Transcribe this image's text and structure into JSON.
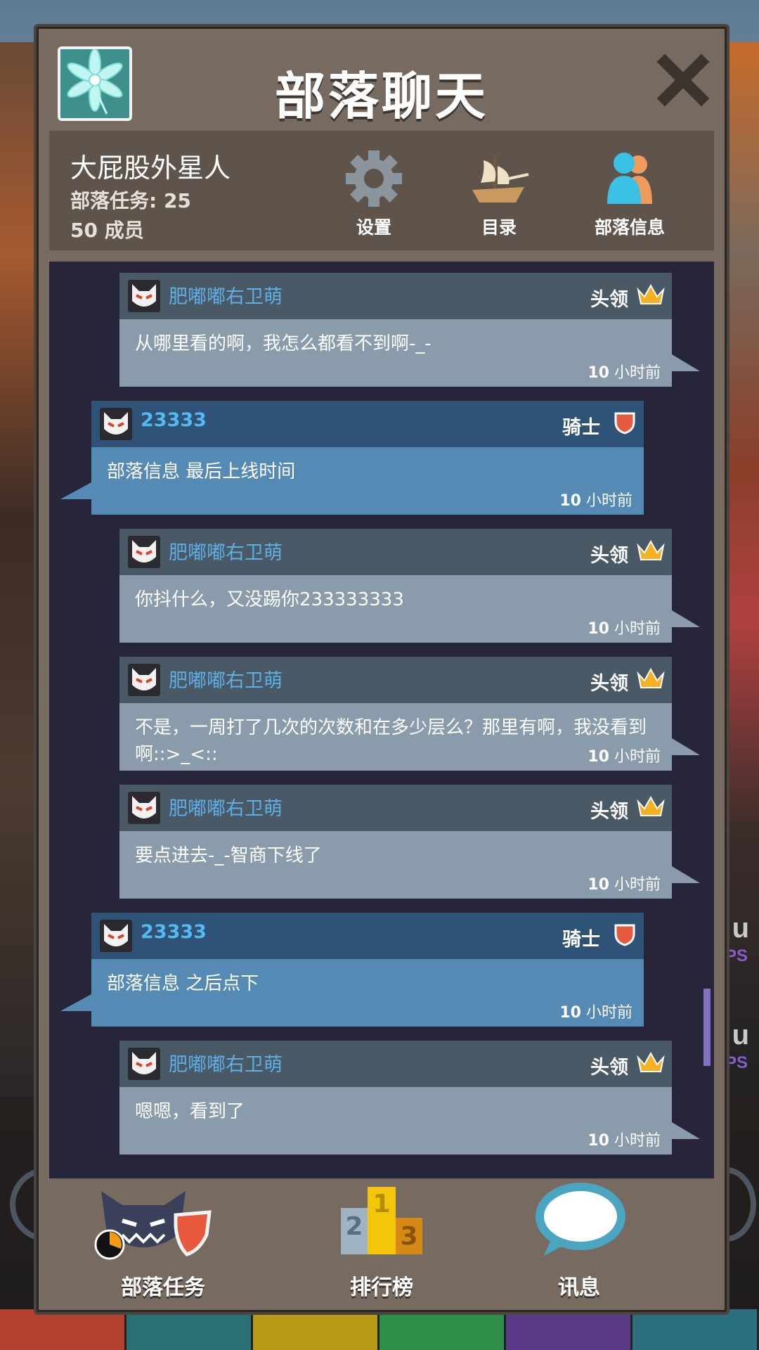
{
  "panel": {
    "title": "部落聊天"
  },
  "clan": {
    "name": "大屁股外星人",
    "missions": "部落任务: 25",
    "members": "50 成员"
  },
  "info_buttons": {
    "settings": "设置",
    "catalog": "目录",
    "clan_info": "部落信息"
  },
  "messages": [
    {
      "sender": "肥嘟嘟右卫萌",
      "rank": "头领",
      "rank_icon": "crown-icon",
      "text": "从哪里看的啊，我怎么都看不到啊-_-",
      "time_num": "10",
      "time_unit": "小时前"
    },
    {
      "sender": "23333",
      "rank": "骑士",
      "rank_icon": "shield-icon",
      "text": "部落信息 最后上线时间",
      "time_num": "10",
      "time_unit": "小时前"
    },
    {
      "sender": "肥嘟嘟右卫萌",
      "rank": "头领",
      "rank_icon": "crown-icon",
      "text": "你抖什么，又没踢你233333333",
      "time_num": "10",
      "time_unit": "小时前"
    },
    {
      "sender": "肥嘟嘟右卫萌",
      "rank": "头领",
      "rank_icon": "crown-icon",
      "text": "不是，一周打了几次的次数和在多少层么？那里有啊，我没看到啊::>_<::",
      "time_num": "10",
      "time_unit": "小时前"
    },
    {
      "sender": "肥嘟嘟右卫萌",
      "rank": "头领",
      "rank_icon": "crown-icon",
      "text": "要点进去-_-智商下线了",
      "time_num": "10",
      "time_unit": "小时前"
    },
    {
      "sender": "23333",
      "rank": "骑士",
      "rank_icon": "shield-icon",
      "text": "部落信息 之后点下",
      "time_num": "10",
      "time_unit": "小时前"
    },
    {
      "sender": "肥嘟嘟右卫萌",
      "rank": "头领",
      "rank_icon": "crown-icon",
      "text": "嗯嗯，看到了",
      "time_num": "10",
      "time_unit": "小时前"
    }
  ],
  "bottom_nav": {
    "missions": "部落任务",
    "leaderboard": "排行榜",
    "messages": "讯息",
    "podium_numbers": [
      "2",
      "1",
      "3"
    ]
  },
  "colors": {
    "panel": "#776b61",
    "chat_bg": "#26253a",
    "leader_head": "#4a5966",
    "leader_body": "#8a9cab",
    "knight_head": "#2e5377",
    "knight_body": "#558ab5",
    "sender_name": "#5eaee6"
  }
}
